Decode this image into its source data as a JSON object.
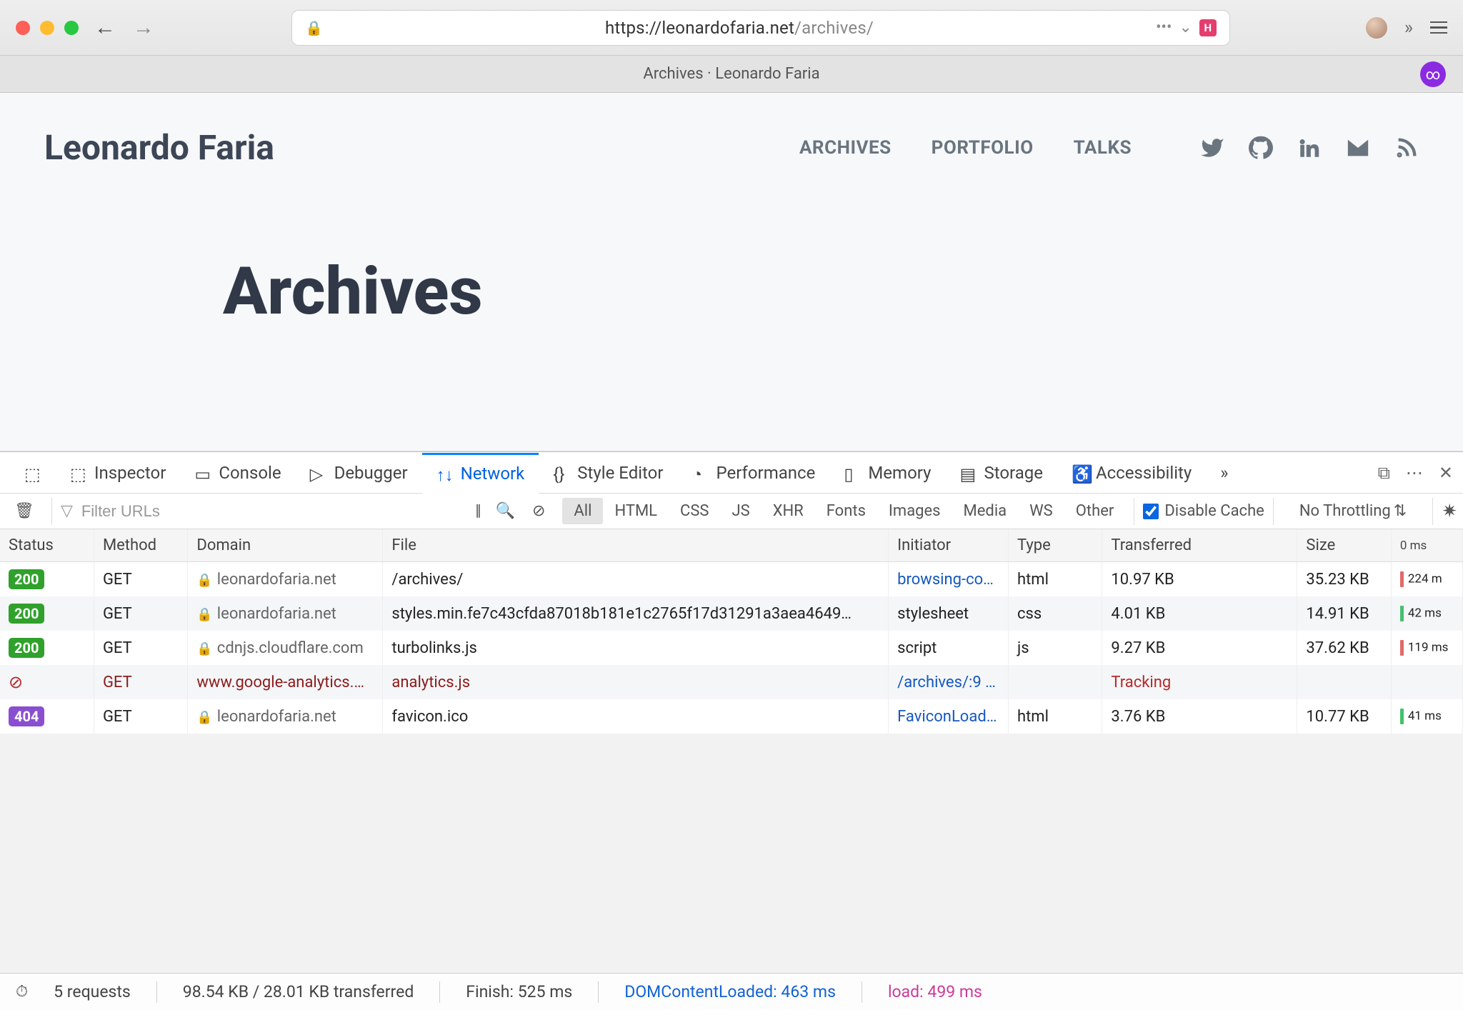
{
  "browser": {
    "url_primary": "https://leonardofaria.net",
    "url_secondary": "/archives/",
    "tab_title": "Archives · Leonardo Faria"
  },
  "page": {
    "site_title": "Leonardo Faria",
    "nav": [
      "ARCHIVES",
      "PORTFOLIO",
      "TALKS"
    ],
    "heading": "Archives"
  },
  "devtools": {
    "tabs": [
      "Inspector",
      "Console",
      "Debugger",
      "Network",
      "Style Editor",
      "Performance",
      "Memory",
      "Storage",
      "Accessibility"
    ],
    "active_tab": "Network",
    "filter_placeholder": "Filter URLs",
    "filter_types": [
      "All",
      "HTML",
      "CSS",
      "JS",
      "XHR",
      "Fonts",
      "Images",
      "Media",
      "WS",
      "Other"
    ],
    "active_filter_type": "All",
    "disable_cache_label": "Disable Cache",
    "disable_cache_checked": true,
    "throttle_label": "No Throttling",
    "columns": [
      "Status",
      "Method",
      "Domain",
      "File",
      "Initiator",
      "Type",
      "Transferred",
      "Size",
      ""
    ],
    "waterfall_header": "0 ms",
    "rows": [
      {
        "status": "200",
        "status_class": "s200",
        "method": "GET",
        "domain": "leonardofaria.net",
        "locked": true,
        "file": "/archives/",
        "initiator": "browsing-co…",
        "init_link": true,
        "type": "html",
        "transferred": "10.97 KB",
        "size": "35.23 KB",
        "wf": "224 m",
        "wf_color": "wf-red"
      },
      {
        "status": "200",
        "status_class": "s200",
        "method": "GET",
        "domain": "leonardofaria.net",
        "locked": true,
        "file": "styles.min.fe7c43cfda87018b181e1c2765f17d31291a3aea4649…",
        "initiator": "stylesheet",
        "init_link": false,
        "type": "css",
        "transferred": "4.01 KB",
        "size": "14.91 KB",
        "wf": "42 ms",
        "wf_color": "wf-green"
      },
      {
        "status": "200",
        "status_class": "s200",
        "method": "GET",
        "domain": "cdnjs.cloudflare.com",
        "locked": true,
        "file": "turbolinks.js",
        "initiator": "script",
        "init_link": false,
        "type": "js",
        "transferred": "9.27 KB",
        "size": "37.62 KB",
        "wf": "119 ms",
        "wf_color": "wf-red"
      },
      {
        "status": "blocked",
        "method": "GET",
        "domain": "www.google-analytics.…",
        "locked": false,
        "file": "analytics.js",
        "initiator": "/archives/:9 …",
        "init_link": true,
        "type": "",
        "transferred": "Tracking",
        "transferred_class": "tracking",
        "size": "",
        "wf": "",
        "row_class": "blocked-row"
      },
      {
        "status": "404",
        "status_class": "s404",
        "method": "GET",
        "domain": "leonardofaria.net",
        "locked": true,
        "file": "favicon.ico",
        "initiator": "FaviconLoad…",
        "init_link": true,
        "type": "html",
        "transferred": "3.76 KB",
        "size": "10.77 KB",
        "wf": "41 ms",
        "wf_color": "wf-green"
      }
    ],
    "status_bar": {
      "requests": "5 requests",
      "transferred": "98.54 KB / 28.01 KB transferred",
      "finish": "Finish: 525 ms",
      "dcl": "DOMContentLoaded: 463 ms",
      "load": "load: 499 ms"
    }
  }
}
